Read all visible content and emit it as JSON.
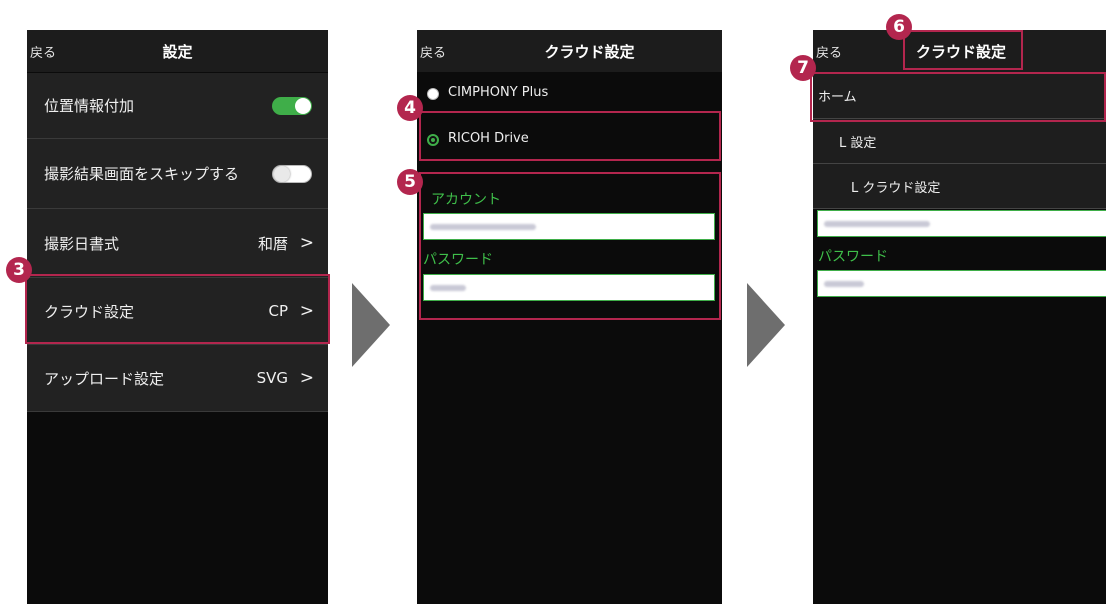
{
  "colors": {
    "accent": "#b3264e",
    "toggle_on": "#3fae49",
    "label_green": "#3fbf4a"
  },
  "screen1": {
    "back": "戻る",
    "title": "設定",
    "rows": [
      {
        "label": "位置情報付加",
        "toggle": "on"
      },
      {
        "label": "撮影結果画面をスキップする",
        "toggle": "off"
      },
      {
        "label": "撮影日書式",
        "value": "和暦"
      },
      {
        "label": "クラウド設定",
        "value": "CP"
      },
      {
        "label": "アップロード設定",
        "value": "SVG"
      }
    ],
    "chevron": ">",
    "badge": "3"
  },
  "screen2": {
    "back": "戻る",
    "title": "クラウド設定",
    "options": [
      {
        "label": "CIMPHONY Plus",
        "selected": false
      },
      {
        "label": "RICOH Drive",
        "selected": true
      }
    ],
    "account_label": "アカウント",
    "password_label": "パスワード",
    "badge4": "4",
    "badge5": "5"
  },
  "screen3": {
    "back": "戻る",
    "title": "クラウド設定",
    "tree": [
      "ホーム",
      "L 設定",
      "L クラウド設定"
    ],
    "password_label": "パスワード",
    "badge6": "6",
    "badge7": "7"
  }
}
